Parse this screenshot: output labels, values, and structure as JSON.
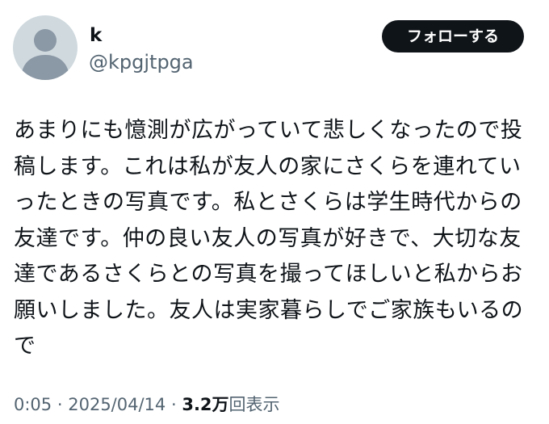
{
  "author": {
    "display_name": "k",
    "handle": "@kpgjtpga"
  },
  "follow_button_label": "フォローする",
  "post": {
    "lines": [
      "あまりにも憶測が広がっていて悲しくなったので投",
      "稿します。これは私が友人の家にさくらを連れてい",
      "ったときの写真です。私とさくらは学生時代からの",
      "友達です。仲の良い友人の写真が好きで、大切な友",
      "達であるさくらとの写真を撮ってほしいと私からお",
      "願いしました。友人は実家暮らしでご家族もいるの",
      "で"
    ]
  },
  "meta": {
    "time": "0:05",
    "separator": "·",
    "date": "2025/04/14",
    "views_count": "3.2万",
    "views_label": "回表示"
  },
  "colors": {
    "text_primary": "#0f1419",
    "text_secondary": "#536471",
    "avatar_background": "#cfd9de",
    "avatar_silhouette": "#8b98a5",
    "button_background": "#0f1419",
    "button_text": "#ffffff"
  },
  "icons": {
    "avatar": "default-profile-silhouette-icon"
  }
}
